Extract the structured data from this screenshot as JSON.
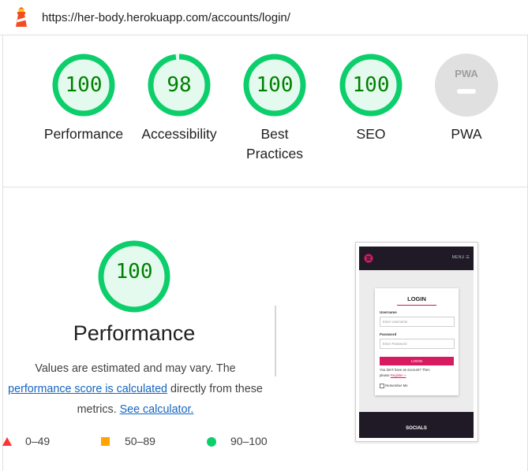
{
  "url": "https://her-body.herokuapp.com/accounts/login/",
  "colors": {
    "pass": "#0cce6b",
    "pass_fill": "#e5faef",
    "pass_text": "#008000",
    "average": "#ffa400",
    "fail": "#ff3333",
    "na": "#e0e0e0"
  },
  "categories": [
    {
      "label": "Performance",
      "score": "100",
      "value": 100
    },
    {
      "label": "Accessibility",
      "score": "98",
      "value": 98
    },
    {
      "label": "Best\nPractices",
      "label_line1": "Best",
      "label_line2": "Practices",
      "score": "100",
      "value": 100
    },
    {
      "label": "SEO",
      "score": "100",
      "value": 100
    },
    {
      "label": "PWA",
      "badge": "PWA"
    }
  ],
  "performance": {
    "score": "100",
    "title": "Performance",
    "disclaimer_prefix": "Values are estimated and may vary. The",
    "link_score": "performance score is calculated",
    "disclaimer_mid": "directly from these",
    "disclaimer_tail": "metrics.",
    "link_calc": "See calculator."
  },
  "legend": [
    {
      "icon": "triangle-icon",
      "range": "0–49"
    },
    {
      "icon": "square-icon",
      "range": "50–89"
    },
    {
      "icon": "circle-icon",
      "range": "90–100"
    }
  ],
  "thumbnail": {
    "menu": "MENU ☰",
    "login_title": "LOGIN",
    "username_label": "Username",
    "username_placeholder": "Enter Username",
    "password_label": "Password",
    "password_placeholder": "Enter Password",
    "login_button": "LOGIN",
    "no_account": "You don't have an account? Then",
    "please": "please",
    "register": "Register »",
    "remember": "Remember Me",
    "socials": "SOCIALS"
  }
}
